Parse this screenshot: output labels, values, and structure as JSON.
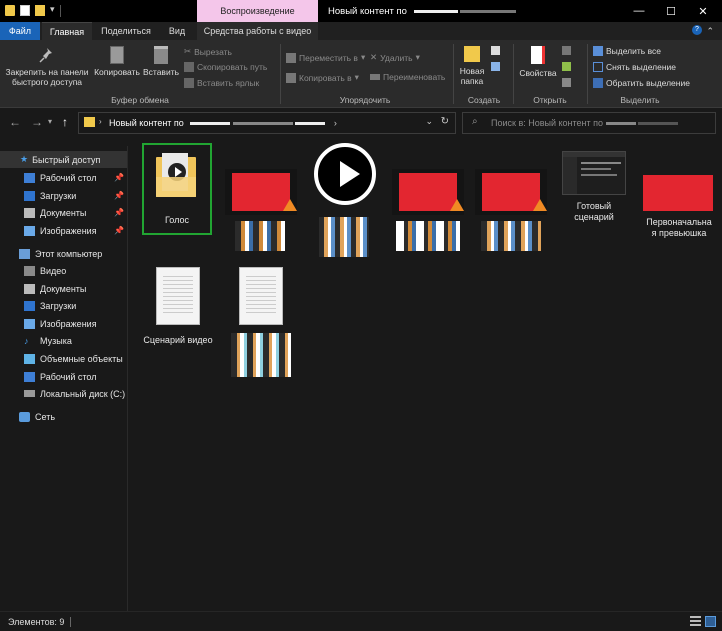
{
  "window": {
    "title": "Новый контент по",
    "contextual_tab": "Воспроизведение",
    "controls": {
      "minimize": "—",
      "maximize": "☐",
      "close": "✕"
    }
  },
  "ribbon_tabs": {
    "file": "Файл",
    "home": "Главная",
    "share": "Поделиться",
    "view": "Вид",
    "video_tools": "Средства работы с видео"
  },
  "ribbon": {
    "clipboard": {
      "label": "Буфер обмена",
      "pin_line1": "Закрепить на панели",
      "pin_line2": "быстрого доступа",
      "copy": "Копировать",
      "paste": "Вставить",
      "cut": "Вырезать",
      "copy_path": "Скопировать путь",
      "paste_shortcut": "Вставить ярлык"
    },
    "organize": {
      "label": "Упорядочить",
      "move_to": "Переместить в",
      "copy_to": "Копировать в",
      "delete": "Удалить",
      "rename": "Переименовать"
    },
    "create": {
      "label": "Создать",
      "new_folder_line1": "Новая",
      "new_folder_line2": "папка"
    },
    "open": {
      "label": "Открыть",
      "properties": "Свойства"
    },
    "select": {
      "label": "Выделить",
      "select_all": "Выделить все",
      "select_none": "Снять выделение",
      "invert": "Обратить выделение"
    }
  },
  "address": {
    "path": "Новый контент по",
    "search_placeholder": "Поиск в: Новый контент по"
  },
  "sidebar": {
    "quick_access": "Быстрый доступ",
    "qa_items": [
      "Рабочий стол",
      "Загрузки",
      "Документы",
      "Изображения"
    ],
    "this_pc": "Этот компьютер",
    "pc_items": [
      "Видео",
      "Документы",
      "Загрузки",
      "Изображения",
      "Музыка",
      "Объемные объекты",
      "Рабочий стол",
      "Локальный диск (C:)"
    ],
    "network": "Сеть"
  },
  "files": {
    "folder": "Голос",
    "ready_script": "Готовый сценарий",
    "ready_script_line1": "Готовый",
    "ready_script_line2": "сценарий",
    "original_preview_line1": "Первоначальна",
    "original_preview_line2": "я превьюшка",
    "video_script": "Сценарий видео"
  },
  "status": {
    "items": "Элементов: 9"
  },
  "colors": {
    "accent": "#1a64b8",
    "contextual": "#f4c6ea",
    "selection": "#21a532",
    "thumbnail_red": "#e32630"
  }
}
